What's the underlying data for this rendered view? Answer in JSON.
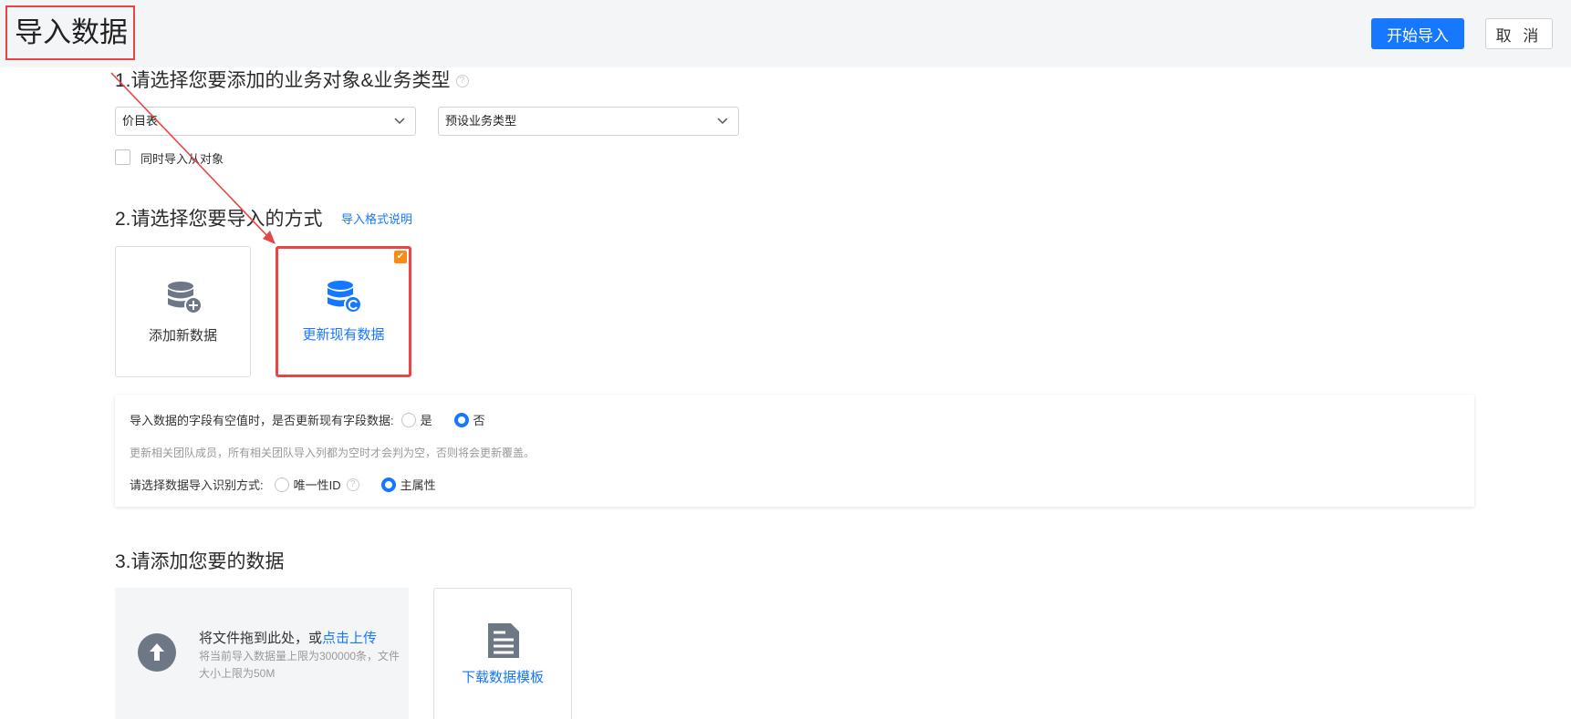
{
  "header": {
    "title": "导入数据",
    "start_label": "开始导入",
    "cancel_label": "取 消"
  },
  "section1": {
    "title": "1.请选择您要添加的业务对象&业务类型",
    "help": "?",
    "object_select": "价目表",
    "type_select": "预设业务类型",
    "import_child_label": "同时导入从对象"
  },
  "section2": {
    "title": "2.请选择您要导入的方式",
    "format_link": "导入格式说明",
    "mode_add": "添加新数据",
    "mode_update": "更新现有数据",
    "selected_check": "✔",
    "empty_field_question": "导入数据的字段有空值时，是否更新现有字段数据:",
    "yes": "是",
    "no": "否",
    "hint": "更新相关团队成员，所有相关团队导入列都为空时才会判为空，否则将会更新覆盖。",
    "identify_label": "请选择数据导入识别方式:",
    "unique_id": "唯一性ID",
    "help": "?",
    "primary_attr": "主属性"
  },
  "section3": {
    "title": "3.请添加您要的数据",
    "drag_text": "将文件拖到此处，或",
    "upload_link": "点击上传",
    "limit_text": "将当前导入数据量上限为300000条，文件大小上限为50M",
    "download_template": "下载数据模板"
  },
  "colors": {
    "primary": "#1677ff",
    "annotation": "#e84646",
    "check": "#fa8c16"
  }
}
